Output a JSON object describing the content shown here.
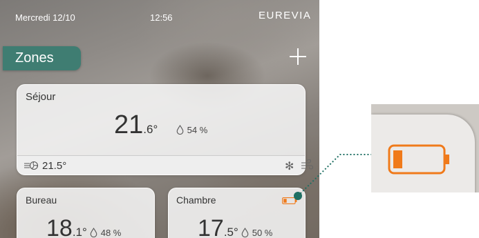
{
  "status_bar": {
    "date": "Mercredi 12/10",
    "time": "12:56",
    "brand": "EUREVIA"
  },
  "header": {
    "zones_label": "Zones",
    "add_icon": "plus-icon"
  },
  "zones": [
    {
      "name": "Séjour",
      "temp_int": "21",
      "temp_dec": ".6°",
      "humidity": "54 %",
      "setpoint": "21.5°",
      "footer_icons": [
        "fan-icon",
        "snowflake-icon",
        "wind-icon"
      ]
    },
    {
      "name": "Bureau",
      "temp_int": "18",
      "temp_dec": ".1°",
      "humidity": "48 %"
    },
    {
      "name": "Chambre",
      "temp_int": "17",
      "temp_dec": ".5°",
      "humidity": "50 %",
      "status_icon": "battery-low-icon"
    }
  ],
  "callout": {
    "icon": "battery-low-icon",
    "accent_color": "#1f6f63",
    "battery_color": "#f07a1a"
  }
}
